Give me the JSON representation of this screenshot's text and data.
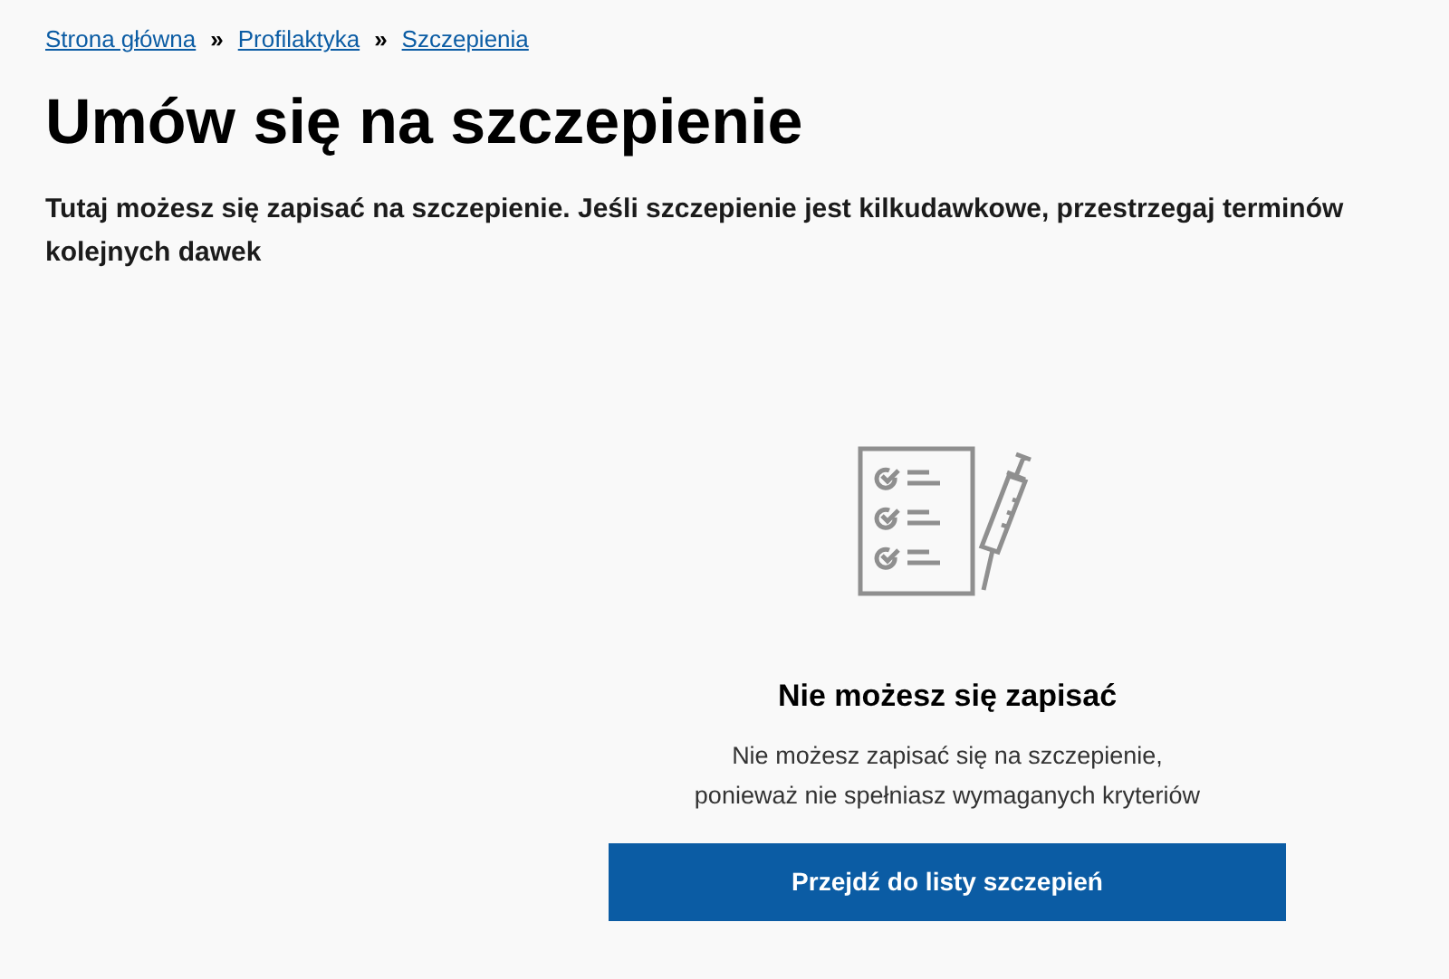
{
  "breadcrumbs": [
    {
      "label": "Strona główna",
      "separator": "»"
    },
    {
      "label": "Profilaktyka",
      "separator": "»"
    },
    {
      "label": "Szczepienia"
    }
  ],
  "title": "Umów się na szczepienie",
  "intro": "Tutaj możesz się zapisać na szczepienie. Jeśli szczepienie jest kilkudawkowe, przestrzegaj terminów kolejnych dawek",
  "notice": {
    "heading": "Nie możesz się zapisać",
    "message_lines": [
      "Nie możesz zapisać się na szczepienie,",
      "ponieważ nie spełniasz wymaganych kryteriów"
    ],
    "button": "Przejdź do listy szczepień"
  }
}
